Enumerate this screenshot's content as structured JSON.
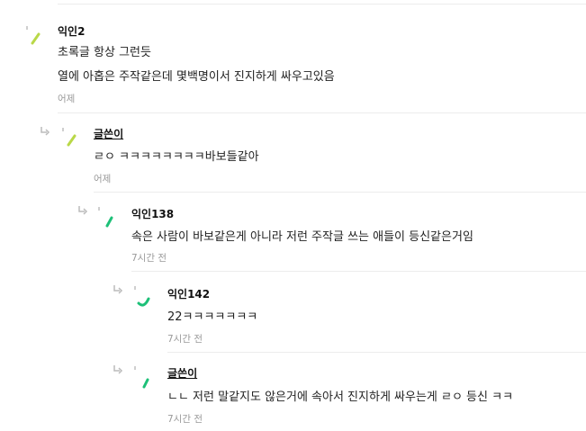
{
  "colors": {
    "avatar_lime": "#b9d848",
    "avatar_green": "#1dc078",
    "divider": "#ececec",
    "time": "#999999",
    "reply_arrow": "#bbbbbb"
  },
  "comments": [
    {
      "author": "익인2",
      "lines": [
        "초록글 항상 그런듯",
        "열에 아홉은 주작같은데 몇백명이서 진지하게 싸우고있음"
      ],
      "time": "어제",
      "avatar_icon": "lime-slash-icon",
      "is_writer": false
    },
    {
      "author": "글쓴이",
      "lines": [
        "ㄹㅇ ㅋㅋㅋㅋㅋㅋㅋㅋ바보들같아"
      ],
      "time": "어제",
      "avatar_icon": "lime-slash-icon",
      "is_writer": true
    },
    {
      "author": "익인138",
      "lines": [
        "속은 사람이 바보같은게 아니라 저런 주작글 쓰는 애들이 등신같은거임"
      ],
      "time": "7시간 전",
      "avatar_icon": "green-stroke-icon",
      "is_writer": false
    },
    {
      "author": "익인142",
      "lines": [
        "22ㅋㅋㅋㅋㅋㅋㅋ"
      ],
      "time": "7시간 전",
      "avatar_icon": "green-arc-icon",
      "is_writer": false
    },
    {
      "author": "글쓴이",
      "lines": [
        "ㄴㄴ 저런 말같지도 않은거에 속아서 진지하게 싸우는게 ㄹㅇ 등신 ㅋㅋ"
      ],
      "time": "7시간 전",
      "avatar_icon": "green-stroke-icon",
      "is_writer": true
    }
  ]
}
